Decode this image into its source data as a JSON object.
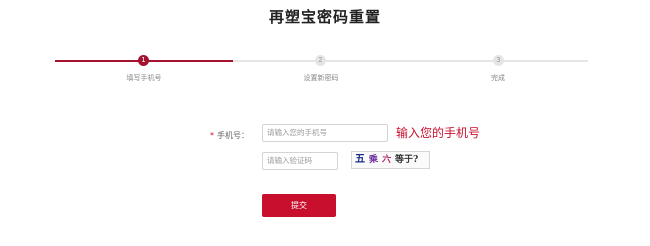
{
  "page": {
    "title": "再塑宝密码重置"
  },
  "steps": [
    {
      "number": "1",
      "label": "填写手机号",
      "active": true
    },
    {
      "number": "2",
      "label": "设置新密码",
      "active": false
    },
    {
      "number": "3",
      "label": "完成",
      "active": false
    }
  ],
  "form": {
    "phone_label": "手机号：",
    "required_mark": "*",
    "phone_placeholder": "请输入您的手机号",
    "phone_hint": "输入您的手机号",
    "code_placeholder": "请输入验证码",
    "captcha": {
      "chars": [
        "五",
        "乘",
        "六",
        "等于?"
      ]
    },
    "submit_label": "提交"
  },
  "colors": {
    "accent": "#a3122e",
    "button": "#c8102e",
    "hint": "#c8102e"
  }
}
